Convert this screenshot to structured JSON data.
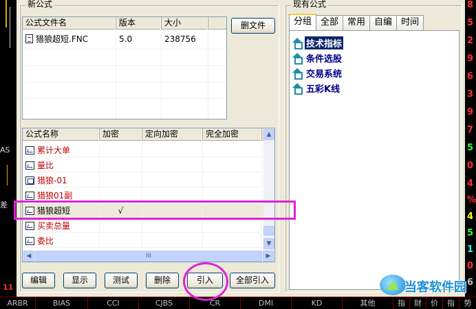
{
  "left_chart": {
    "label_top": "AS",
    "label_mid": "差"
  },
  "new_formula": {
    "legend": "新公式",
    "files_table": {
      "headers": [
        "公式文件名",
        "版本",
        "大小"
      ],
      "rows": [
        {
          "name": "猎狼超短.FNC",
          "version": "5.0",
          "size": "238756"
        }
      ]
    },
    "delete_file_button": "删文件",
    "formula_table": {
      "headers": [
        "公式名称",
        "加密",
        "定向加密",
        "完全加密"
      ],
      "rows": [
        {
          "name": "累计大单",
          "encrypt": "",
          "directed": "",
          "full": "",
          "icon": "chart-icon"
        },
        {
          "name": "量比",
          "encrypt": "",
          "directed": "",
          "full": "",
          "icon": "chart-icon"
        },
        {
          "name": "猎狼-01",
          "encrypt": "",
          "directed": "",
          "full": "",
          "icon": "bar-chart-icon"
        },
        {
          "name": "猎狼01副",
          "encrypt": "",
          "directed": "",
          "full": "",
          "icon": "chart-icon"
        },
        {
          "name": "猎狼超短",
          "encrypt": "√",
          "directed": "",
          "full": "",
          "icon": "chart-icon"
        },
        {
          "name": "买卖总量",
          "encrypt": "",
          "directed": "",
          "full": "",
          "icon": "chart-icon"
        },
        {
          "name": "委比",
          "encrypt": "",
          "directed": "",
          "full": "",
          "icon": "chart-icon"
        }
      ],
      "hscroll_grip": "III"
    },
    "buttons": {
      "edit": "编辑",
      "show": "显示",
      "test": "测试",
      "delete": "删除",
      "import": "引入",
      "import_all": "全部引入"
    }
  },
  "existing_formula": {
    "legend": "现有公式",
    "tabs": [
      "分组",
      "全部",
      "常用",
      "自编",
      "时间"
    ],
    "active_tab": "分组",
    "tree": [
      "技术指标",
      "条件选股",
      "交易系统",
      "五彩K线"
    ]
  },
  "right_strip": [
    {
      "text": "8",
      "color": "#ff3030"
    },
    {
      "text": "5",
      "color": "#ff3030"
    },
    {
      "text": "2",
      "color": "#ff3030"
    },
    {
      "text": "9",
      "color": "#ff3030"
    },
    {
      "text": "6",
      "color": "#ff3030"
    },
    {
      "text": "3",
      "color": "#ff3030"
    },
    {
      "text": "9",
      "color": "#ff3030"
    },
    {
      "text": "7",
      "color": "#ff3030"
    },
    {
      "text": "5",
      "color": "#33ff33"
    },
    {
      "text": "0",
      "color": "#ff3030"
    },
    {
      "text": "4",
      "color": "#ff3030"
    },
    {
      "text": "%",
      "color": "#ff3030"
    },
    {
      "text": "4",
      "color": "#ffff00"
    },
    {
      "text": "5",
      "color": "#33ff33"
    },
    {
      "text": "1",
      "color": "#33ffff"
    },
    {
      "text": "0",
      "color": "#ff3030"
    },
    {
      "text": "6",
      "color": "#c0c0c0"
    }
  ],
  "bottom_tabs": [
    "ARBR",
    "BIAS",
    "CCI",
    "CJBS",
    "CR",
    "DMI",
    "KD",
    "其他",
    "指",
    "财",
    "价",
    "指",
    "势"
  ],
  "watermark": "当客软件园"
}
